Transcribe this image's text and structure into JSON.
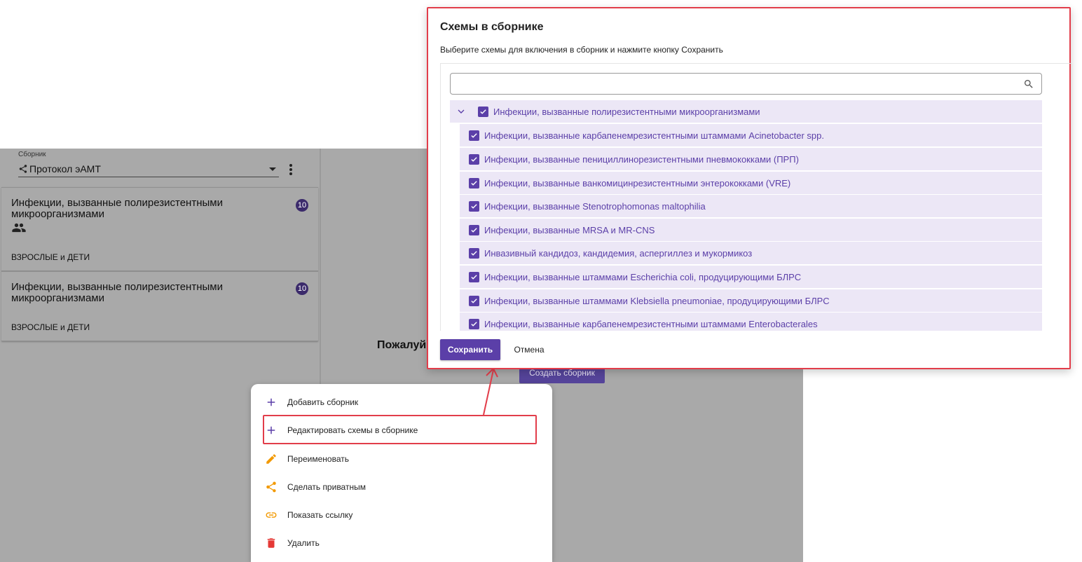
{
  "sidebar": {
    "collection_label": "Сборник",
    "collection_value": "Протокол эАМТ",
    "cards": [
      {
        "title": "Инфекции, вызванные полирезистентными микроорганизмами",
        "badge": "10",
        "age": "ВЗРОСЛЫЕ и ДЕТИ",
        "shared": true
      },
      {
        "title": "Инфекции, вызванные полирезистентными микроорганизмами",
        "badge": "10",
        "age": "ВЗРОСЛЫЕ и ДЕТИ",
        "shared": false
      }
    ]
  },
  "main": {
    "please_text": "Пожалуй",
    "create_button": "Создать сборник"
  },
  "menu": {
    "items": [
      {
        "label": "Добавить сборник",
        "icon": "plus-icon"
      },
      {
        "label": "Редактировать схемы в сборнике",
        "icon": "plus-icon"
      },
      {
        "label": "Переименовать",
        "icon": "pencil-icon"
      },
      {
        "label": "Сделать приватным",
        "icon": "share-icon"
      },
      {
        "label": "Показать ссылку",
        "icon": "link-icon"
      },
      {
        "label": "Удалить",
        "icon": "trash-icon"
      }
    ]
  },
  "dialog": {
    "title": "Схемы в сборнике",
    "subtitle": "Выберите схемы для включения в сборник и нажмите кнопку Сохранить",
    "search_placeholder": "",
    "root": {
      "label": "Инфекции, вызванные полирезистентными микроорганизмами",
      "checked": true,
      "expanded": true
    },
    "children": [
      {
        "label": "Инфекции, вызванные карбапенемрезистентными штаммами Acinetobacter spp.",
        "checked": true
      },
      {
        "label": "Инфекции, вызванные пенициллинорезистентными пневмококками (ПРП)",
        "checked": true
      },
      {
        "label": "Инфекции, вызванные ванкомицинрезистентными энтерококками (VRE)",
        "checked": true
      },
      {
        "label": "Инфекции, вызванные Stenotrophomonas maltophilia",
        "checked": true
      },
      {
        "label": "Инфекции, вызванные MRSA и MR-CNS",
        "checked": true
      },
      {
        "label": "Инвазивный кандидоз, кандидемия, аспергиллез и мукормикоз",
        "checked": true
      },
      {
        "label": "Инфекции, вызванные штаммами Escherichia coli, продуцирующими БЛРС",
        "checked": true
      },
      {
        "label": "Инфекции, вызванные штаммами Klebsiella pneumoniae, продуцирующими БЛРС",
        "checked": true
      },
      {
        "label": "Инфекции, вызванные карбапенемрезистентными штаммами Enterobacterales",
        "checked": true
      }
    ],
    "save_label": "Сохранить",
    "cancel_label": "Отмена"
  },
  "colors": {
    "accent": "#5b3fa8",
    "highlight_border": "#e23d4a",
    "tree_row_bg": "#ece7f6",
    "menu_icon_orange": "#f29900",
    "menu_icon_red": "#e53935"
  }
}
